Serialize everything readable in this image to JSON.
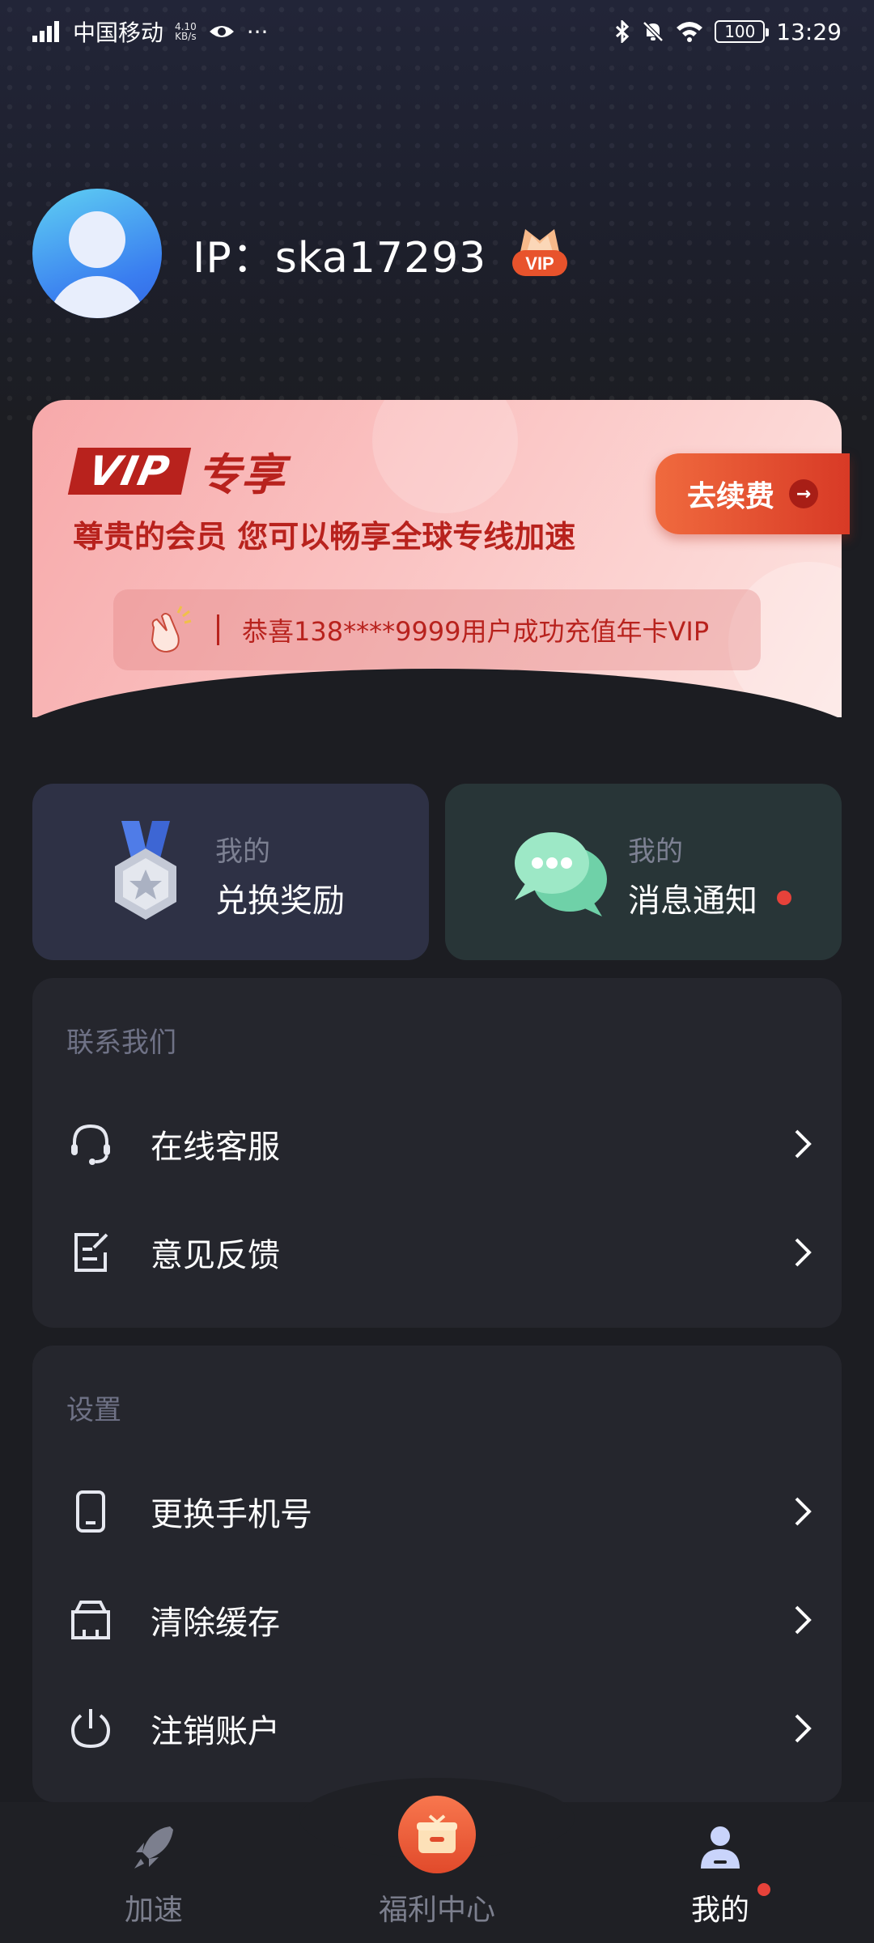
{
  "status_bar": {
    "carrier": "中国移动",
    "speed_value": "4.10",
    "speed_unit": "KB/s",
    "more": "···",
    "battery": "100",
    "time": "13:29"
  },
  "profile": {
    "name": "IP：ska17293",
    "vip_badge_text": "VIP"
  },
  "vip_card": {
    "vip_box": "VIP",
    "vip_label": "专享",
    "subtitle": "尊贵的会员 您可以畅享全球专线加速",
    "renew_button": "去续费",
    "notice": "恭喜138****9999用户成功充值年卡VIP"
  },
  "quick_cards": [
    {
      "small": "我的",
      "big": "兑换奖励"
    },
    {
      "small": "我的",
      "big": "消息通知"
    }
  ],
  "contact_section": {
    "title": "联系我们",
    "items": [
      {
        "label": "在线客服",
        "icon": "headset-icon"
      },
      {
        "label": "意见反馈",
        "icon": "feedback-icon"
      }
    ]
  },
  "settings_section": {
    "title": "设置",
    "items": [
      {
        "label": "更换手机号",
        "icon": "phone-icon"
      },
      {
        "label": "清除缓存",
        "icon": "clear-cache-icon"
      },
      {
        "label": "注销账户",
        "icon": "power-icon"
      }
    ]
  },
  "bottom_nav": {
    "items": [
      {
        "label": "加速",
        "icon": "rocket-icon",
        "active": false
      },
      {
        "label": "福利中心",
        "icon": "gift-icon",
        "active": false
      },
      {
        "label": "我的",
        "icon": "user-icon",
        "active": true
      }
    ]
  },
  "colors": {
    "accent_red": "#b8221d",
    "button_orange": "#e14a2b",
    "notification_dot": "#e6423a",
    "background": "#1c1d22",
    "card": "#25262d"
  }
}
